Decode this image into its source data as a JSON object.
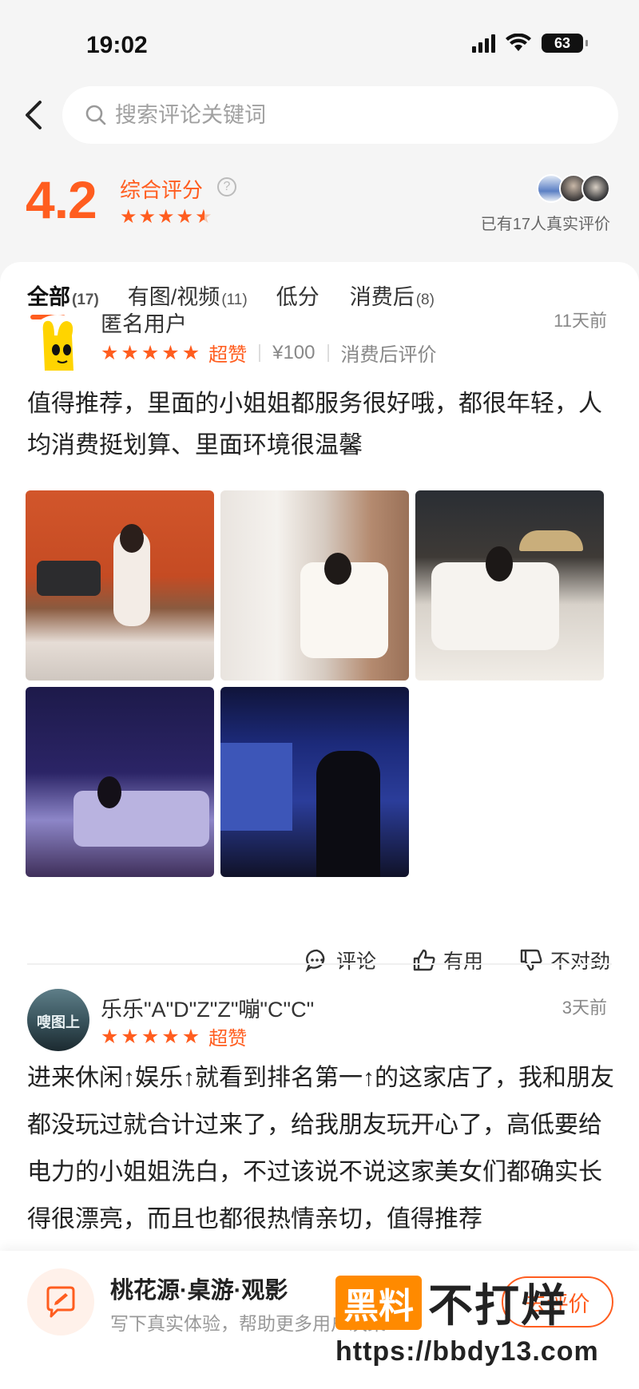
{
  "status_bar": {
    "time": "19:02",
    "battery": "63"
  },
  "search": {
    "placeholder": "搜索评论关键词"
  },
  "summary": {
    "score": "4.2",
    "label": "综合评分",
    "real_count_text": "已有17人真实评价"
  },
  "tabs": [
    {
      "label": "全部",
      "count": "(17)"
    },
    {
      "label": "有图/视频",
      "count": "(11)"
    },
    {
      "label": "低分",
      "count": ""
    },
    {
      "label": "消费后",
      "count": "(8)"
    }
  ],
  "reviews": [
    {
      "name": "匿名用户",
      "time": "11天前",
      "rating_word": "超赞",
      "price": "¥100",
      "tag": "消费后评价",
      "text": "值得推荐，里面的小姐姐都服务很好哦，都很年轻，人均消费挺划算、里面环境很温馨",
      "photo_count": 5
    },
    {
      "name": "乐乐\"A\"D\"Z\"Z\"嘣\"C\"C\"",
      "time": "3天前",
      "rating_word": "超赞",
      "text": "进来休闲↑娱乐↑就看到排名第一↑的这家店了，我和朋友都没玩过就合计过来了，给我朋友玩开心了，高低要给电力的小姐姐洗白，不过该说不说这家美女们都确实长得很漂亮，而且也都很热情亲切，值得推荐",
      "avatar_text": "嗖图上"
    }
  ],
  "actions": {
    "comment": "评论",
    "useful": "有用",
    "wrong": "不对劲"
  },
  "bottom": {
    "shop_name": "桃花源·桌游·观影",
    "hint": "写下真实体验，帮助更多用户决策",
    "button": "去评价"
  },
  "watermark": {
    "badge": "黑料",
    "text": "不打烊",
    "url": "https://bbdy13.com"
  },
  "colors": {
    "accent": "#ff5d1f",
    "background": "#f5f5f5"
  }
}
